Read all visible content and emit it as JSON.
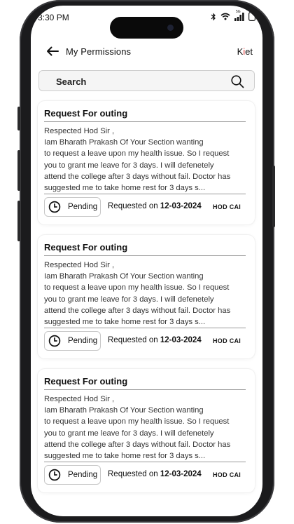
{
  "status_bar": {
    "time": "3:30 PM",
    "network": "5G"
  },
  "header": {
    "title": "My Permissions",
    "brand_prefix": "K",
    "brand_dot": "i",
    "brand_suffix": "et"
  },
  "search": {
    "placeholder": "Search"
  },
  "requests": [
    {
      "title": "Request For outing",
      "body_lines": [
        "Respected Hod Sir ,",
        "Iam Bharath Prakash Of Your Section wanting",
        "to request a leave upon my health issue. So I request",
        "you to grant me leave for 3 days. I will defenetely",
        "attend the college after 3 days without fail. Doctor has",
        "suggested me to take home rest for 3 days s..."
      ],
      "status": "Pending",
      "requested_prefix": "Requested on",
      "date": "12-03-2024",
      "approver": "HOD CAI"
    },
    {
      "title": "Request For outing",
      "body_lines": [
        "Respected Hod Sir ,",
        "Iam Bharath Prakash Of Your Section wanting",
        "to request a leave upon my health issue. So I request",
        "you to grant me leave for 3 days. I will defenetely",
        "attend the college after 3 days without fail. Doctor has",
        "suggested me to take home rest for 3 days s..."
      ],
      "status": "Pending",
      "requested_prefix": "Requested on",
      "date": "12-03-2024",
      "approver": "HOD CAI"
    },
    {
      "title": "Request For outing",
      "body_lines": [
        "Respected Hod Sir ,",
        "Iam Bharath Prakash Of Your Section wanting",
        "to request a leave upon my health issue. So I request",
        "you to grant me leave for 3 days. I will defenetely",
        "attend the college after 3 days without fail. Doctor has",
        "suggested me to take home rest for 3 days s..."
      ],
      "status": "Pending",
      "requested_prefix": "Requested on",
      "date": "12-03-2024",
      "approver": "HOD CAI"
    }
  ],
  "icons": {
    "back": "arrow-left-icon",
    "search": "search-icon",
    "status": "clock-icon",
    "bluetooth": "bluetooth-icon",
    "wifi": "wifi-icon",
    "signal": "signal-icon",
    "battery": "battery-icon"
  },
  "colors": {
    "brand_accent": "#e23b3b"
  }
}
